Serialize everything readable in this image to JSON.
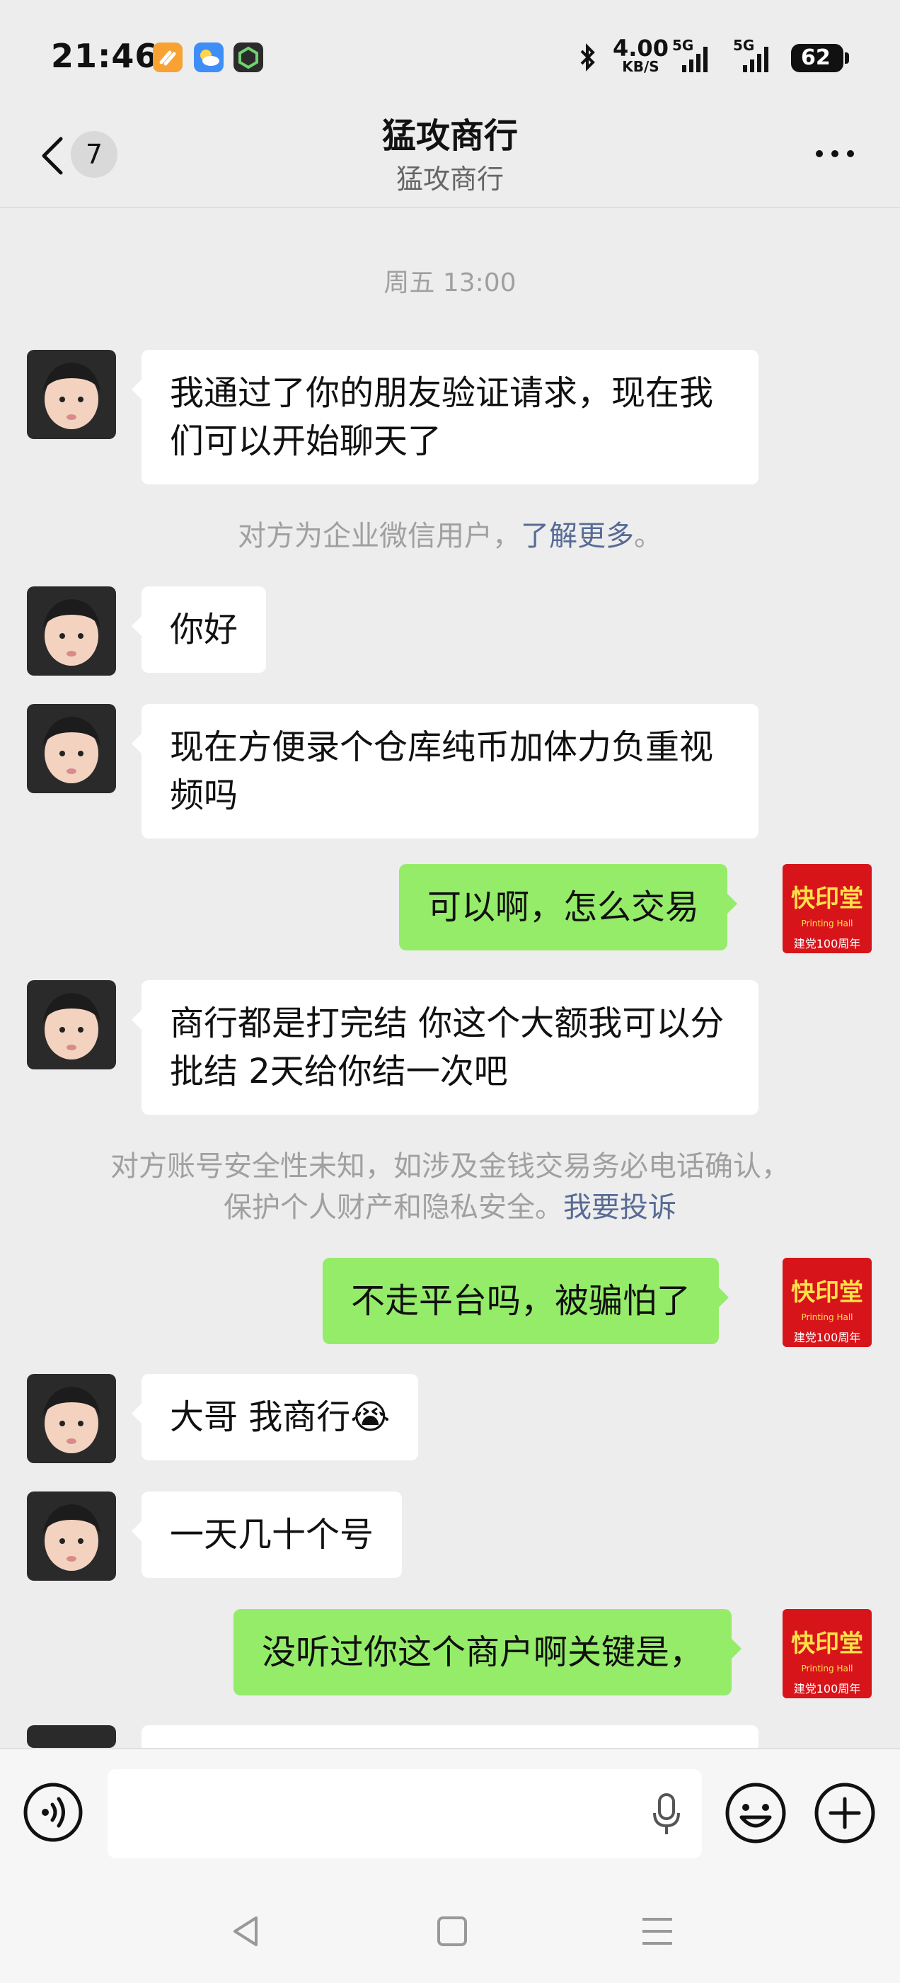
{
  "status_bar": {
    "time": "21:46",
    "network_speed": "4.00",
    "network_speed_unit": "KB/S",
    "signal1": "5G",
    "signal2": "5G",
    "battery": "62",
    "app_icons": [
      "slash-app-icon",
      "weather-app-icon",
      "shield-app-icon"
    ]
  },
  "header": {
    "back_icon": "chevron-left-icon",
    "unread_count": "7",
    "title": "猛攻商行",
    "subtitle": "猛攻商行",
    "more_icon": "more-dots-icon"
  },
  "chat": {
    "timestamp": "周五 13:00",
    "messages": [
      {
        "side": "left",
        "text": "我通过了你的朋友验证请求，现在我们可以开始聊天了"
      },
      {
        "side": "left",
        "text": "你好"
      },
      {
        "side": "left",
        "text": "现在方便录个仓库纯币加体力负重视频吗"
      },
      {
        "side": "right",
        "text": "可以啊，怎么交易"
      },
      {
        "side": "left",
        "text": "商行都是打完结 你这个大额我可以分批结 2天给你结一次吧"
      },
      {
        "side": "right",
        "text": "不走平台吗，被骗怕了"
      },
      {
        "side": "left",
        "text": "大哥 我商行😭"
      },
      {
        "side": "left",
        "text": "一天几十个号"
      },
      {
        "side": "right",
        "text": "没听过你这个商户啊关键是，"
      }
    ],
    "system_notice_1": {
      "text": "对方为企业微信用户，",
      "link": "了解更多",
      "suffix": "。"
    },
    "system_notice_2": {
      "line1": "对方账号安全性未知，如涉及金钱交易务必电话确认，",
      "line2": "保护个人财产和隐私安全。",
      "link": "我要投诉"
    },
    "my_avatar_text": {
      "main": "快印堂",
      "sub": "Printing Hall",
      "footer": "建党100周年"
    }
  },
  "input_bar": {
    "voice_icon": "voice-mode-icon",
    "mic_icon": "microphone-icon",
    "emoji_icon": "emoji-icon",
    "plus_icon": "plus-icon"
  },
  "nav_bar": {
    "back": "nav-back-icon",
    "home": "nav-home-icon",
    "menu": "nav-menu-icon"
  },
  "colors": {
    "bg": "#ededed",
    "bubble_right": "#95ec69",
    "bubble_left": "#ffffff",
    "link": "#576b95",
    "system_text": "#a0a0a0"
  }
}
